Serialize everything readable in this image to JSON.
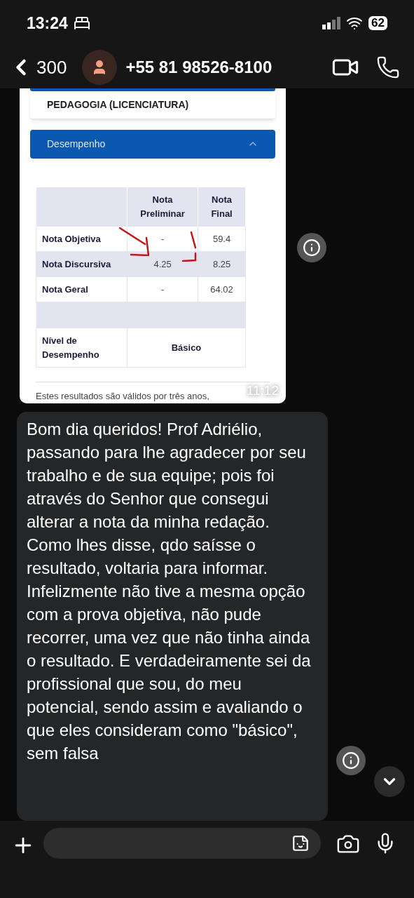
{
  "status_bar": {
    "time": "13:24",
    "battery": "62"
  },
  "header": {
    "back_count": "300",
    "contact": "+55 81 98526-8100"
  },
  "image_message": {
    "course": "PEDAGOGIA (LICENCIATURA)",
    "section": {
      "title": "Desempenho",
      "expanded": true
    },
    "table": {
      "columns": [
        "Nota Preliminar",
        "Nota Final"
      ],
      "rows": [
        {
          "label": "Nota Objetiva",
          "cells": [
            "-",
            "59.4"
          ]
        },
        {
          "label": "Nota Discursiva",
          "cells": [
            "4.25",
            "8.25"
          ]
        },
        {
          "label": "Nota Geral",
          "cells": [
            "-",
            "64.02"
          ]
        }
      ],
      "level_row": {
        "label": "Nível de Desempenho",
        "value": "Básico"
      }
    },
    "footnote": "Estes resultados são válidos por três anos,",
    "time": "11:12"
  },
  "text_message": {
    "text": "Bom dia queridos! Prof Adriélio, passando para lhe agradecer por seu trabalho e de sua equipe; pois foi através do Senhor que consegui alterar a nota da minha redação. Como lhes disse, qdo saísse o resultado, voltaria para informar. Infelizmente não tive a mesma opção com a prova objetiva, não  pude recorrer, uma vez que não tinha ainda o resultado. E verdadeiramente sei da profissional que sou, do meu potencial, sendo assim e avaliando o que eles consideram como \"básico\", sem falsa"
  }
}
